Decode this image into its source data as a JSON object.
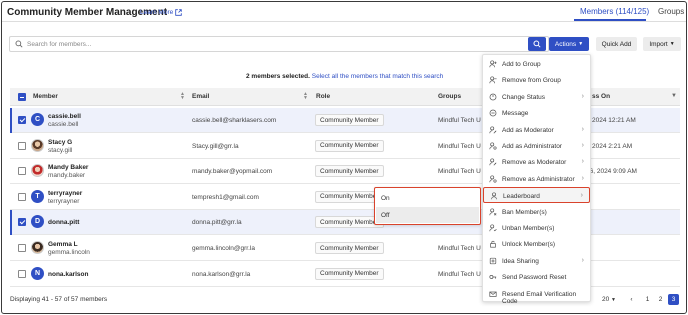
{
  "header": {
    "title": "Community Member Management",
    "learn_more": "Learn More",
    "tabs": [
      {
        "label": "Members (114/125)",
        "active": true
      },
      {
        "label": "Groups",
        "active": false
      }
    ]
  },
  "toolbar": {
    "search_placeholder": "Search for members...",
    "actions_label": "Actions",
    "quick_add_label": "Quick Add",
    "import_label": "Import"
  },
  "selection": {
    "text": "2 members selected.",
    "select_all_link": "Select all the members that match this search"
  },
  "table": {
    "columns": [
      "Member",
      "Email",
      "Role",
      "Groups",
      "ss On"
    ],
    "rows": [
      {
        "name": "cassie.bell",
        "username": "cassie.bell",
        "email": "cassie.bell@sharklasers.com",
        "role": "Community Member",
        "group": "Mindful Tech U",
        "date": "2024 12:21 AM",
        "selected": true,
        "avatar_letter": "C",
        "avatar": "letter"
      },
      {
        "name": "Stacy G",
        "username": "stacy.gill",
        "email": "Stacy.gill@grr.la",
        "role": "Community Member",
        "group": "Mindful Tech U",
        "date": "2024 2:21 AM",
        "selected": false,
        "avatar_letter": "",
        "avatar": "photo1"
      },
      {
        "name": "Mandy Baker",
        "username": "mandy.baker",
        "email": "mandy.baker@yopmail.com",
        "role": "Community Member",
        "group": "Mindful Tech U",
        "date": "26, 2024 9:09 AM",
        "selected": false,
        "avatar_letter": "",
        "avatar": "photo2"
      },
      {
        "name": "terryrayner",
        "username": "terryrayner",
        "email": "tempresh1@gmail.com",
        "role": "Community Membe",
        "group": "",
        "date": "",
        "selected": false,
        "avatar_letter": "T",
        "avatar": "letter"
      },
      {
        "name": "donna.pitt",
        "username": "",
        "email": "donna.pitt@grr.la",
        "role": "Community Member",
        "group": "",
        "date": "",
        "selected": true,
        "avatar_letter": "D",
        "avatar": "letter"
      },
      {
        "name": "Gemma L",
        "username": "gemma.lincoln",
        "email": "gemma.lincoln@grr.la",
        "role": "Community Member",
        "group": "Mindful Tech U",
        "date": "",
        "selected": false,
        "avatar_letter": "",
        "avatar": "photo3"
      },
      {
        "name": "nona.karlson",
        "username": "",
        "email": "nona.karlson@grr.la",
        "role": "Community Member",
        "group": "Mindful Tech U",
        "date": "",
        "selected": false,
        "avatar_letter": "N",
        "avatar": "letter"
      }
    ]
  },
  "actions_menu": [
    {
      "label": "Add to Group",
      "icon": "add-user-icon",
      "submenu": false
    },
    {
      "label": "Remove from Group",
      "icon": "remove-user-icon",
      "submenu": false
    },
    {
      "label": "Change Status",
      "icon": "status-icon",
      "submenu": true
    },
    {
      "label": "Message",
      "icon": "message-icon",
      "submenu": false
    },
    {
      "label": "Add as Moderator",
      "icon": "moderator-icon",
      "submenu": true
    },
    {
      "label": "Add as Administrator",
      "icon": "admin-icon",
      "submenu": true
    },
    {
      "label": "Remove as Moderator",
      "icon": "moderator-icon",
      "submenu": true
    },
    {
      "label": "Remove as Administrator",
      "icon": "admin-icon",
      "submenu": true
    },
    {
      "label": "Leaderboard",
      "icon": "leaderboard-icon",
      "submenu": true,
      "highlighted": true
    },
    {
      "label": "Ban Member(s)",
      "icon": "ban-icon",
      "submenu": false
    },
    {
      "label": "Unban Member(s)",
      "icon": "unban-icon",
      "submenu": false
    },
    {
      "label": "Unlock Member(s)",
      "icon": "unlock-icon",
      "submenu": false
    },
    {
      "label": "Idea Sharing",
      "icon": "idea-icon",
      "submenu": true
    },
    {
      "label": "Send Password Reset",
      "icon": "key-icon",
      "submenu": false
    },
    {
      "label": "Resend Email Verification Code",
      "icon": "mail-icon",
      "submenu": false
    }
  ],
  "leaderboard_submenu": [
    {
      "label": "On"
    },
    {
      "label": "Off",
      "hover": true
    }
  ],
  "footer": {
    "displaying": "Displaying 41 - 57 of 57 members",
    "per_page": "20",
    "pages": [
      "1",
      "2",
      "3"
    ],
    "active_page": "3"
  },
  "colors": {
    "accent": "#2f4fc4",
    "highlight": "#d9432c"
  }
}
